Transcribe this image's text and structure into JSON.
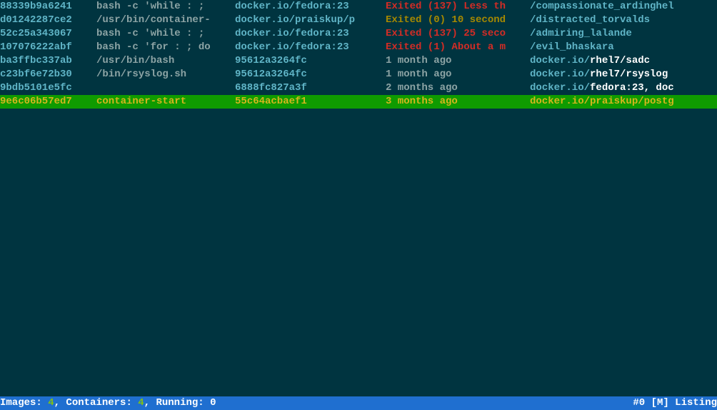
{
  "rows": [
    {
      "id": "88339b9a6241",
      "command": "bash -c 'while : ;",
      "image": "docker.io/fedora:23",
      "status_class": "c-red",
      "status": "Exited (137) Less th",
      "name_prefix": "",
      "name_main": "/compassionate_ardinghel",
      "selected": false
    },
    {
      "id": "d01242287ce2",
      "command": "/usr/bin/container-",
      "image": "docker.io/praiskup/p",
      "status_class": "c-yellow",
      "status": "Exited (0) 10 second",
      "name_prefix": "",
      "name_main": "/distracted_torvalds",
      "selected": false
    },
    {
      "id": "52c25a343067",
      "command": "bash -c 'while : ;",
      "image": "docker.io/fedora:23",
      "status_class": "c-red",
      "status": "Exited (137) 25 seco",
      "name_prefix": "",
      "name_main": "/admiring_lalande",
      "selected": false
    },
    {
      "id": "107076222abf",
      "command": "bash -c 'for : ; do",
      "image": "docker.io/fedora:23",
      "status_class": "c-red",
      "status": "Exited (1) About a m",
      "name_prefix": "",
      "name_main": "/evil_bhaskara",
      "selected": false
    },
    {
      "id": "ba3ffbc337ab",
      "command": "/usr/bin/bash",
      "image": "95612a3264fc",
      "status_class": "c-gray",
      "status": "1 month ago",
      "name_prefix": "docker.io/",
      "name_main": "rhel7/sadc",
      "selected": false
    },
    {
      "id": "c23bf6e72b30",
      "command": "/bin/rsyslog.sh",
      "image": "95612a3264fc",
      "status_class": "c-gray",
      "status": "1 month ago",
      "name_prefix": "docker.io/",
      "name_main": "rhel7/rsyslog",
      "selected": false
    },
    {
      "id": "9bdb5101e5fc",
      "command": "",
      "image": "6888fc827a3f",
      "status_class": "c-gray",
      "status": "2 months ago",
      "name_prefix": "docker.io/",
      "name_main": "fedora:23, doc",
      "selected": false
    },
    {
      "id": "9e6c06b57ed7",
      "command": "container-start",
      "image": "55c64acbaef1",
      "status_class": "c-yellow-bright",
      "status": "3 months ago",
      "name_prefix": "",
      "name_main": "docker.io/praiskup/postg",
      "selected": true
    }
  ],
  "status": {
    "images_label": "Images: ",
    "images_count": "4",
    "containers_label": ", Containers: ",
    "containers_count": "4",
    "running_label": ", Running: ",
    "running_count": "0",
    "right": "#0 [M] Listing"
  }
}
